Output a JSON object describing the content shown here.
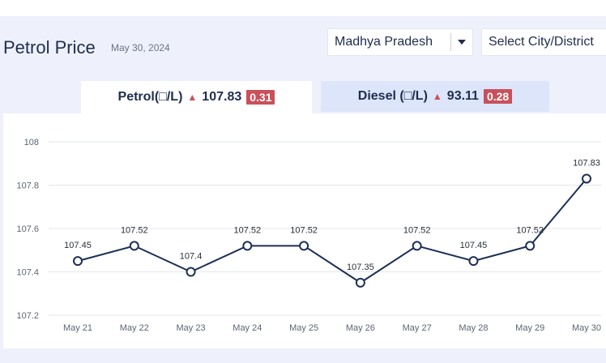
{
  "header": {
    "title": "Petrol Price",
    "date": "May 30, 2024",
    "state_value": "Madhya Pradesh",
    "city_placeholder": "Select City/District"
  },
  "tabs": {
    "petrol": {
      "label": "Petrol(□/L)",
      "price": "107.83",
      "change": "0.31"
    },
    "diesel": {
      "label": "Diesel (□/L)",
      "price": "93.11",
      "change": "0.28"
    }
  },
  "colors": {
    "accent_up": "#c9505a",
    "line": "#1c2f55",
    "title": "#1f2d4d",
    "active_tab": "#ffffff",
    "inactive_tab": "#dde5fb"
  },
  "icons": {
    "up": "triangle-up-icon",
    "dropdown": "caret-down-icon"
  },
  "chart_data": {
    "type": "line",
    "title": "",
    "xlabel": "",
    "ylabel": "",
    "categories": [
      "May 21",
      "May 22",
      "May 23",
      "May 24",
      "May 25",
      "May 26",
      "May 27",
      "May 28",
      "May 29",
      "May 30"
    ],
    "series": [
      {
        "values": [
          107.45,
          107.52,
          107.4,
          107.52,
          107.52,
          107.35,
          107.52,
          107.45,
          107.52,
          107.83
        ]
      }
    ],
    "data_labels": [
      "107.45",
      "107.52",
      "107.4",
      "107.52",
      "107.52",
      "107.35",
      "107.52",
      "107.45",
      "107.52",
      "107.83"
    ],
    "yticks": [
      107.2,
      107.4,
      107.6,
      107.8,
      108
    ],
    "ytick_labels": [
      "107.2",
      "107.4",
      "107.6",
      "107.8",
      "108"
    ],
    "ylim": [
      107.2,
      108
    ],
    "grid": true,
    "legend": "none"
  }
}
